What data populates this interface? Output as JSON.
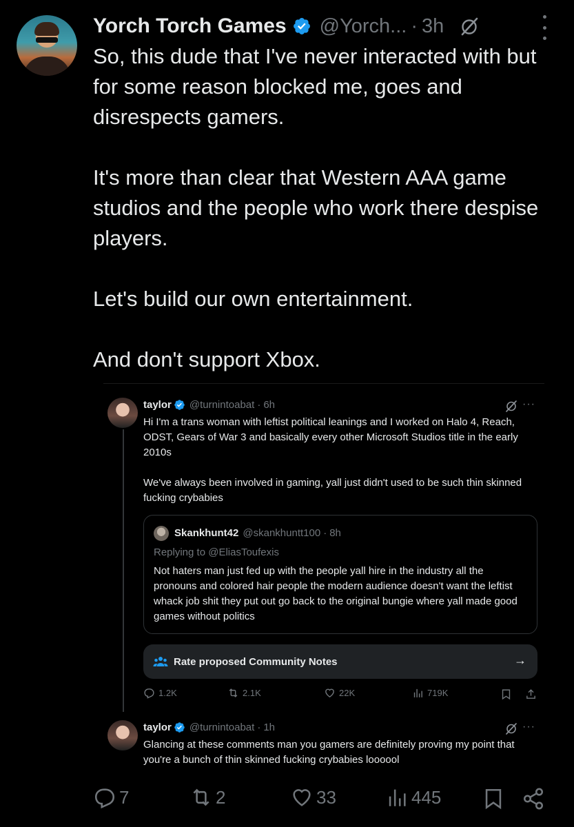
{
  "post": {
    "display_name": "Yorch Torch Games",
    "handle": "@Yorch...",
    "separator": "·",
    "time": "3h",
    "paragraphs": [
      "So, this dude that I've never interacted with but for some reason blocked me, goes and disrespects gamers.",
      "It's more than clear that Western AAA game studios and the people who work there despise players.",
      "Let's build our own entertainment.",
      "And don't support Xbox."
    ]
  },
  "embed": {
    "tweet1": {
      "name": "taylor",
      "handle": "@turnintoabat",
      "separator": "·",
      "time": "6h",
      "more": "···",
      "paragraphs": [
        "Hi I'm a trans woman with leftist political leanings and I worked on Halo 4, Reach, ODST, Gears of War 3 and basically every other Microsoft Studios title in the early 2010s",
        "We've always been involved in gaming, yall just didn't used to be such thin skinned fucking crybabies"
      ]
    },
    "quote": {
      "name": "Skankhunt42",
      "handle": "@skankhuntt100",
      "separator": "·",
      "time": "8h",
      "replying": "Replying to @EliasToufexis",
      "text": "Not haters man just fed up with the people yall hire in the industry all the pronouns and colored hair people the modern audience doesn't want the leftist whack job shit they put out go back to the original bungie where yall made good games without politics"
    },
    "community_notes": {
      "label": "Rate proposed Community Notes",
      "arrow": "→"
    },
    "actions": {
      "replies": "1.2K",
      "reposts": "2.1K",
      "likes": "22K",
      "views": "719K"
    },
    "tweet2": {
      "name": "taylor",
      "handle": "@turnintoabat",
      "separator": "·",
      "time": "1h",
      "more": "···",
      "text": "Glancing at these comments man you gamers are definitely proving my point that you're a bunch of thin skinned fucking crybabies loooool"
    }
  },
  "bottom_actions": {
    "replies": "7",
    "reposts": "2",
    "likes": "33",
    "views": "445"
  },
  "colors": {
    "background": "#000000",
    "text": "#e7e9ea",
    "muted": "#71767b",
    "verified": "#1d9bf0",
    "border": "#2f3336"
  }
}
